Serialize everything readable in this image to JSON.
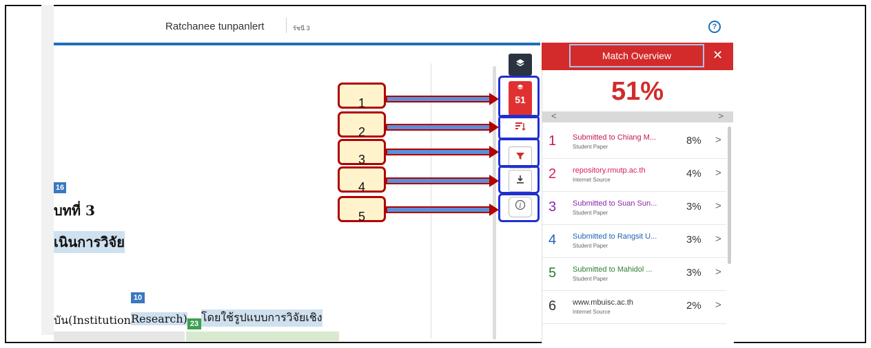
{
  "header": {
    "author": "Ratchanee tunpanlert",
    "tag": "รัชนี 3",
    "help_icon": "?"
  },
  "document": {
    "badges": [
      "16",
      "10",
      "23"
    ],
    "lines": [
      "บทที่ 3",
      "เนินการวิจัย",
      "บัน(Institution ",
      "Research)",
      "โดยใช้รูปแบบการวิจัยเชิง"
    ]
  },
  "toolbar": {
    "layers_icon": "layers-icon",
    "similarity_count": "51"
  },
  "callouts": [
    "1",
    "2",
    "3",
    "4",
    "5"
  ],
  "panel": {
    "title": "Match Overview",
    "close": "✕",
    "percent": "51%",
    "nav_prev": "<",
    "nav_next": ">",
    "chevron": ">",
    "matches": [
      {
        "rank": "1",
        "title": "Submitted to Chiang M...",
        "type": "Student Paper",
        "percent": "8%",
        "color": "#c2185b"
      },
      {
        "rank": "2",
        "title": "repository.rmutp.ac.th",
        "type": "Internet Source",
        "percent": "4%",
        "color": "#d81b60"
      },
      {
        "rank": "3",
        "title": "Submitted to Suan Sun...",
        "type": "Student Paper",
        "percent": "3%",
        "color": "#8e24aa"
      },
      {
        "rank": "4",
        "title": "Submitted to Rangsit U...",
        "type": "Student Paper",
        "percent": "3%",
        "color": "#1e5fb5"
      },
      {
        "rank": "5",
        "title": "Submitted to Mahidol ...",
        "type": "Student Paper",
        "percent": "3%",
        "color": "#2e7d32"
      },
      {
        "rank": "6",
        "title": "www.mbuisc.ac.th",
        "type": "Internet Source",
        "percent": "2%",
        "color": "#333333"
      }
    ]
  }
}
